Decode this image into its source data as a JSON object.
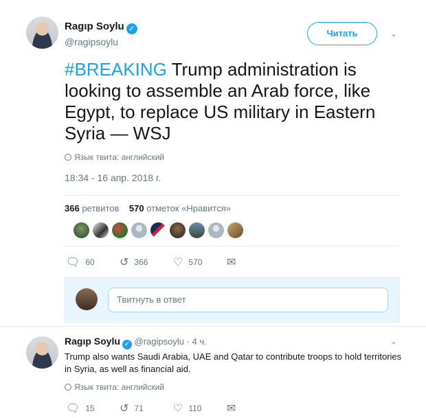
{
  "tweet": {
    "author_name": "Ragıp Soylu",
    "author_handle": "@ragipsoylu",
    "verified_badge": "✓",
    "follow_label": "Читать",
    "hashtag": "#BREAKING",
    "text": " Trump administration is looking to assemble an Arab force, like Egypt, to replace US military in Eastern Syria — WSJ",
    "language": "Язык твита: английский",
    "timestamp": "18:34 - 16 апр. 2018 г.",
    "retweets_count": "366",
    "retweets_label": "ретвитов",
    "likes_count": "570",
    "likes_label": "отметок «Нравится»",
    "likers_count": 9,
    "actions": {
      "replies": "60",
      "retweets": "366",
      "likes": "570"
    }
  },
  "reply_composer": {
    "placeholder": "Твитнуть в ответ"
  },
  "reply": {
    "author_name": "Ragıp Soylu",
    "author_handle": "@ragipsoylu",
    "time": "· 4 ч.",
    "text": "Trump also wants Saudi Arabia, UAE and Qatar to contribute troops to hold territories in Syria, as well as financial aid.",
    "language": "Язык твита: английский",
    "actions": {
      "replies": "15",
      "retweets": "71",
      "likes": "110"
    }
  },
  "icons": {
    "reply": "reply-icon",
    "retweet": "retweet-icon",
    "like": "heart-icon",
    "message": "envelope-icon",
    "caret": "chevron-down-icon",
    "globe": "globe-icon"
  },
  "colors": {
    "accent": "#1da1f2",
    "muted": "#657786",
    "text": "#14171a"
  }
}
